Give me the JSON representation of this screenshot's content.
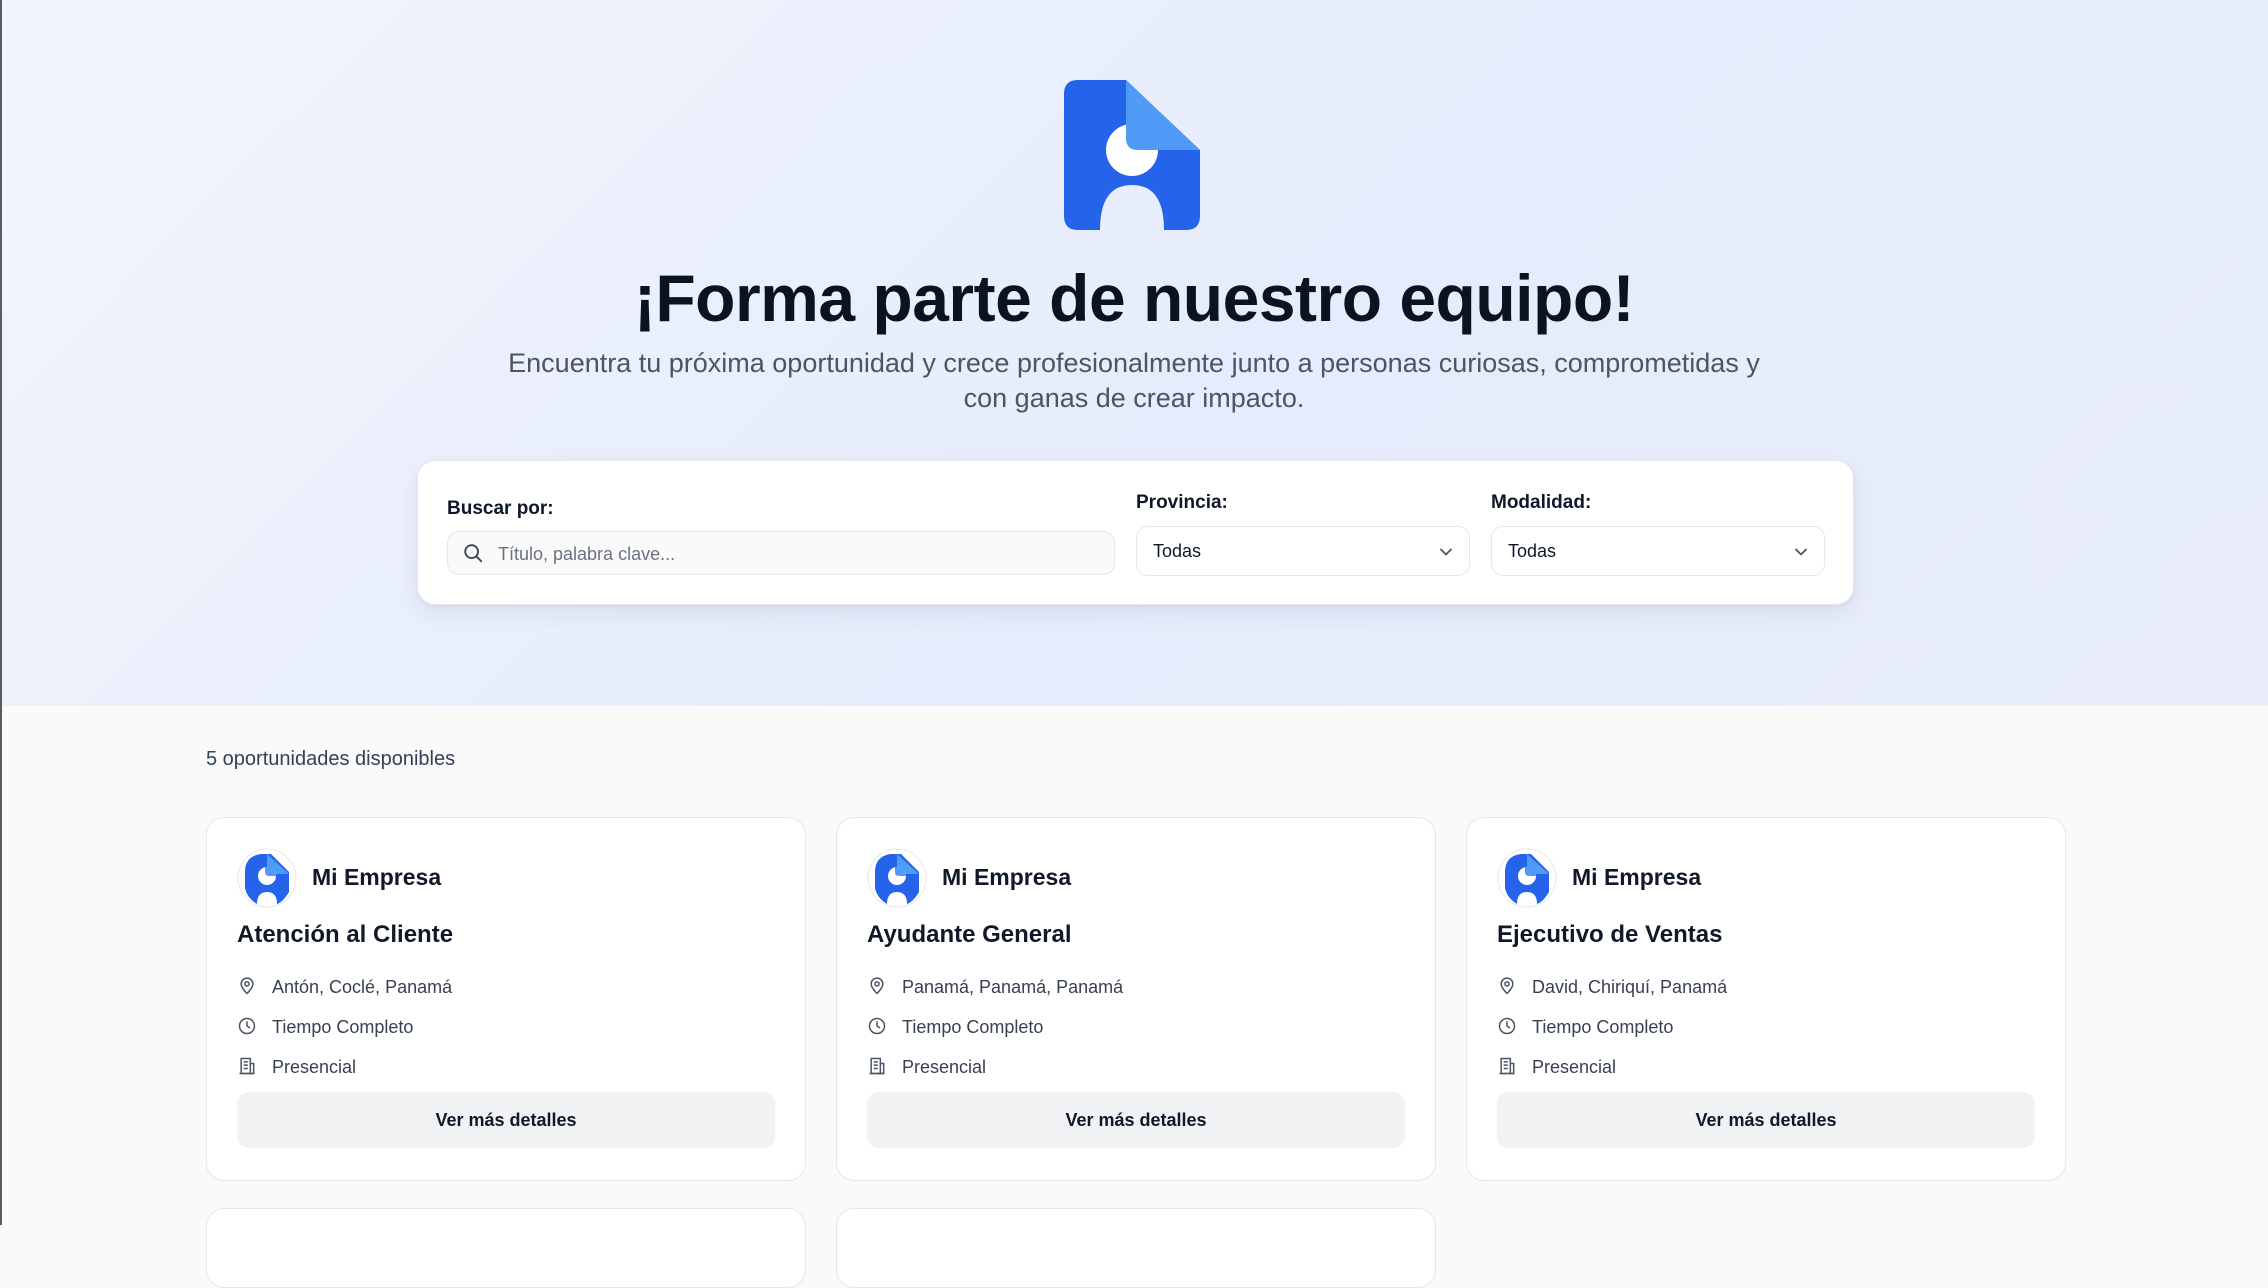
{
  "hero": {
    "title": "¡Forma parte de nuestro equipo!",
    "subtitle_line1": "Encuentra tu próxima oportunidad y crece profesionalmente junto a personas curiosas, comprometidas y",
    "subtitle_line2": "con ganas de crear impacto.",
    "logo_icon": "person-document-logo",
    "brand_colors": {
      "primary": "#2563eb",
      "light": "#4f9bf7"
    }
  },
  "filters": {
    "search_label": "Buscar por:",
    "search_placeholder": "Título, palabra clave...",
    "search_value": "",
    "province_label": "Provincia:",
    "province_value": "Todas",
    "modality_label": "Modalidad:",
    "modality_value": "Todas"
  },
  "results": {
    "count_text": "5 oportunidades disponibles",
    "jobs": [
      {
        "company": "Mi Empresa",
        "title": "Atención al Cliente",
        "location": "Antón, Coclé, Panamá",
        "schedule": "Tiempo Completo",
        "modality": "Presencial",
        "button": "Ver más detalles"
      },
      {
        "company": "Mi Empresa",
        "title": "Ayudante General",
        "location": "Panamá, Panamá, Panamá",
        "schedule": "Tiempo Completo",
        "modality": "Presencial",
        "button": "Ver más detalles"
      },
      {
        "company": "Mi Empresa",
        "title": "Ejecutivo de Ventas",
        "location": "David, Chiriquí, Panamá",
        "schedule": "Tiempo Completo",
        "modality": "Presencial",
        "button": "Ver más detalles"
      }
    ]
  }
}
